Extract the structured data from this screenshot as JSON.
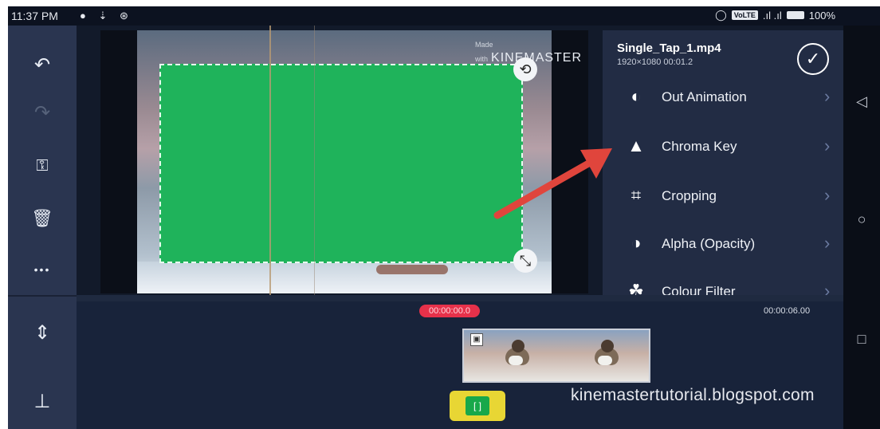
{
  "status_bar": {
    "time": "11:37 PM",
    "notif_icons": [
      "whatsapp-icon",
      "download-icon",
      "sync-icon"
    ],
    "volte": "VoLTE",
    "battery": "100%"
  },
  "left_toolbar": {
    "items": [
      {
        "name": "undo-icon",
        "glyph": "↶"
      },
      {
        "name": "redo-icon",
        "glyph": "↷"
      },
      {
        "name": "key-icon",
        "glyph": "⚿"
      },
      {
        "name": "trash-icon",
        "glyph": "🗑"
      },
      {
        "name": "more-icon",
        "glyph": "•••"
      },
      {
        "name": "split-icon",
        "glyph": "⇕"
      },
      {
        "name": "pin-icon",
        "glyph": "⊥"
      }
    ]
  },
  "preview": {
    "watermark_small": "Made with",
    "watermark": "KINEMASTER"
  },
  "panel": {
    "clip_name": "Single_Tap_1.mp4",
    "clip_info": "1920×1080  00:01.2",
    "done_label": "✓",
    "menu": [
      {
        "label": "Out Animation",
        "icon": "animation-icon",
        "glyph": "◐"
      },
      {
        "label": "Chroma Key",
        "icon": "chroma-key-icon",
        "glyph": "▲"
      },
      {
        "label": "Cropping",
        "icon": "crop-icon",
        "glyph": "⌗"
      },
      {
        "label": "Alpha (Opacity)",
        "icon": "opacity-icon",
        "glyph": "◑"
      },
      {
        "label": "Colour Filter",
        "icon": "colour-filter-icon",
        "glyph": "☘"
      }
    ],
    "chevron": "›"
  },
  "timeline": {
    "current_time": "00:00:00.0",
    "end_time": "00:00:06.00"
  },
  "blog": "kinemastertutorial.blogspot.com",
  "colors": {
    "chroma_green": "#1fb35b",
    "panel_bg": "#222c44",
    "arrow_red": "#e0453c"
  }
}
